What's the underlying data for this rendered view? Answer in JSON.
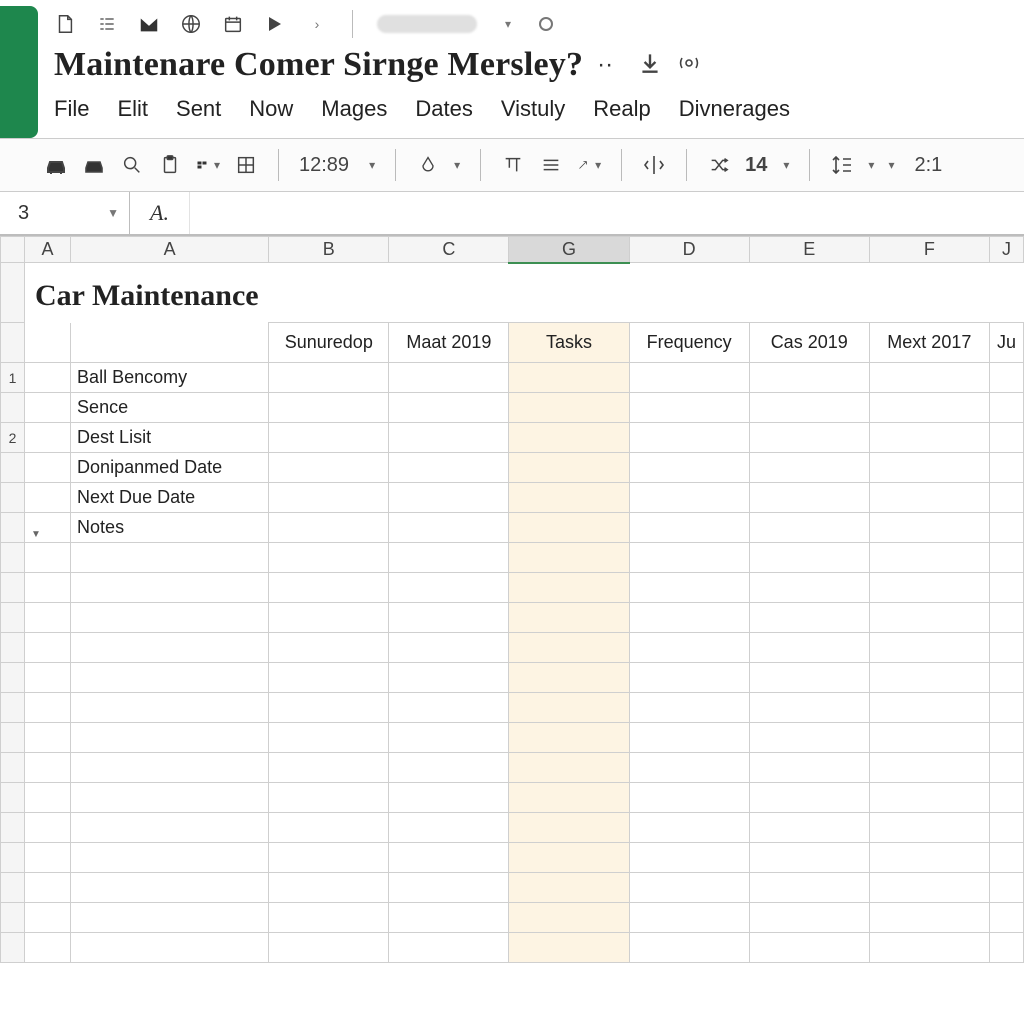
{
  "brand_glyph": "",
  "doc_title": "Maintenare Comer Sirnge Mersley?",
  "doc_title_suffix": "··",
  "menu": [
    "File",
    "Elit",
    "Sent",
    "Now",
    "Mages",
    "Dates",
    "Vistuly",
    "Realp",
    "Divnerages"
  ],
  "toolbar": {
    "time_value": "12:89",
    "num_value": "14",
    "right_readout": "2:1"
  },
  "namebox_value": "3",
  "fx_label": "A.",
  "formula_value": "",
  "sheet": {
    "title": "Car Maintenance",
    "col_letters_row1": [
      "A",
      "A",
      "B",
      "C",
      "G",
      "D",
      "E",
      "F",
      "J"
    ],
    "selected_col_index": 4,
    "headers": [
      "Sunuredop",
      "Maat 2019",
      "Tasks",
      "Frequency",
      "Cas 2019",
      "Mext 2017",
      "Ju"
    ],
    "row_labels": [
      {
        "num": "1",
        "lines": [
          "Ball Bencomy",
          "Sence"
        ]
      },
      {
        "num": "2",
        "lines": [
          "Dest Lisit",
          "Donipanmed Date",
          " Next Due Date",
          "Notes"
        ]
      }
    ],
    "blank_rows": 14
  }
}
